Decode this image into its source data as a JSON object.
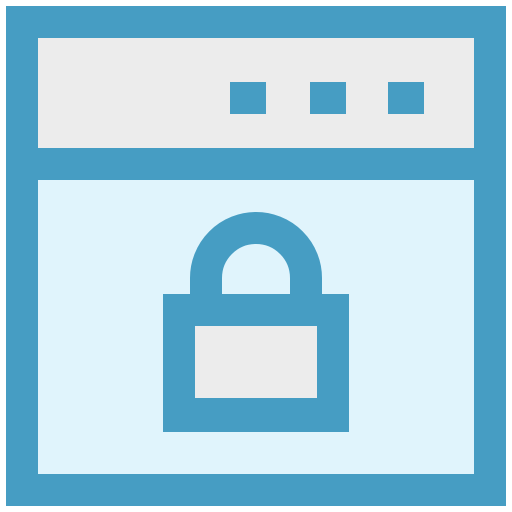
{
  "icon": {
    "name": "secure-browser-window-icon",
    "window": {
      "frame_color": "#469DC3",
      "titlebar_color": "#ECECEC",
      "content_color": "#E0F4FC",
      "window_controls": [
        "dot-icon",
        "dot-icon",
        "dot-icon"
      ]
    },
    "lock": {
      "name": "padlock-icon",
      "outline_color": "#469DC3",
      "body_color": "#ECECEC"
    }
  }
}
